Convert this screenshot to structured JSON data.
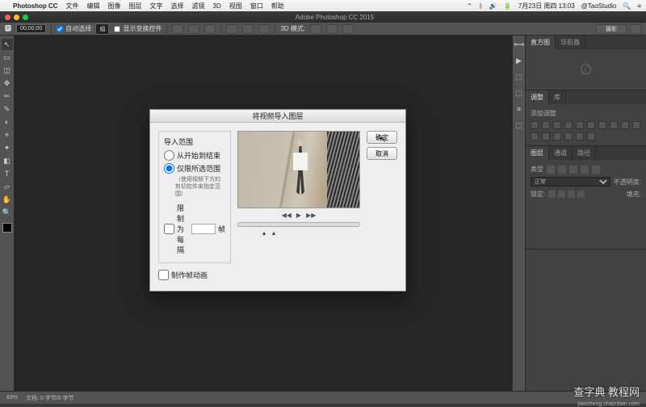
{
  "menubar": {
    "apple": "",
    "app": "Photoshop CC",
    "items": [
      "文件",
      "编辑",
      "图像",
      "图层",
      "文字",
      "选择",
      "滤镜",
      "3D",
      "视图",
      "窗口",
      "帮助"
    ],
    "status": {
      "date": "7月23日 周四 13:03",
      "user": "@TaoStudio",
      "search": "🔍",
      "menu": "≡"
    }
  },
  "titlebar": {
    "title": "Adobe Photoshop CC 2015"
  },
  "optbar": {
    "timecode": "00;00;00",
    "autoselect": "自动选择:",
    "autoselect_mode": "组",
    "show_transform": "显示变换控件",
    "threed_mode": "3D 模式:"
  },
  "tools": [
    "↖",
    "▭",
    "◫",
    "✥",
    "✂",
    "✎",
    "◐",
    "⌖",
    "✦",
    "◧",
    "T",
    "▱",
    "✋",
    "🔍"
  ],
  "dock_icons": [
    "⟷",
    "▶",
    "⬚",
    "⬚",
    "≡",
    "⬚"
  ],
  "panels": {
    "nav": {
      "tabs": [
        "直方图",
        "导航器"
      ],
      "empty_icon": "∅"
    },
    "adj": {
      "tabs": [
        "调整",
        "库"
      ],
      "title": "添加调整"
    },
    "layers": {
      "tabs": [
        "图层",
        "通道",
        "路径"
      ],
      "kind": "类型",
      "mode": "正常",
      "opacity_label": "不透明度:",
      "lock_label": "锁定:",
      "fill_label": "填充:"
    }
  },
  "dialog": {
    "title": "将视频导入图层",
    "range_title": "导入范围",
    "opt_all": "从开始到结束",
    "opt_sel": "仅限所选范围",
    "opt_sel_sub": "（使用视频下方的剪切控件来指定范围）",
    "limit_label": "限制为每隔",
    "limit_unit": "帧",
    "make_anim": "制作帧动画",
    "ok": "确定",
    "cancel": "取消",
    "play_prev": "◀◀",
    "play": "▶",
    "play_next": "▶▶"
  },
  "status": {
    "zoom": "83%",
    "meta": "文档: 0 字节/0 字节"
  },
  "watermark": {
    "main": "查字典 教程网",
    "sub": "jiaocheng.chazidian.com"
  }
}
